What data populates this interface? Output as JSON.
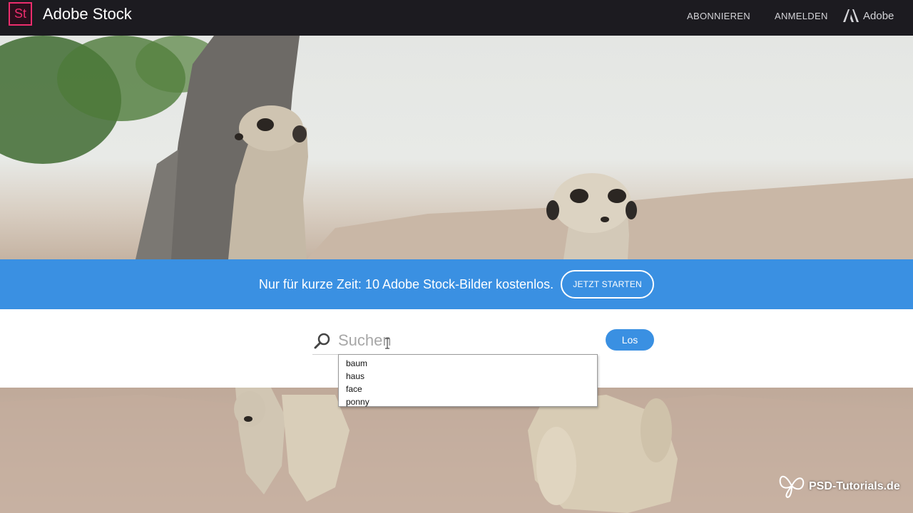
{
  "header": {
    "logo_text": "St",
    "title": "Adobe Stock",
    "nav": {
      "subscribe": "ABONNIEREN",
      "login": "ANMELDEN",
      "adobe": "Adobe"
    }
  },
  "promo": {
    "text": "Nur für kurze Zeit: 10 Adobe Stock-Bilder kostenlos.",
    "cta": "JETZT STARTEN"
  },
  "search": {
    "placeholder": "Suchen",
    "value": "",
    "button": "Los",
    "suggestions": [
      "baum",
      "haus",
      "face",
      "ponny"
    ]
  },
  "watermark": "PSD-Tutorials.de",
  "colors": {
    "accent_blue": "#3a90e2",
    "topbar": "#1c1b20",
    "stock_pink": "#ec2d6d"
  },
  "icons": {
    "logo": "adobe-stock-logo",
    "adobe": "adobe-icon",
    "search": "search-icon",
    "cursor": "text-cursor-icon",
    "watermark": "butterfly-icon"
  }
}
